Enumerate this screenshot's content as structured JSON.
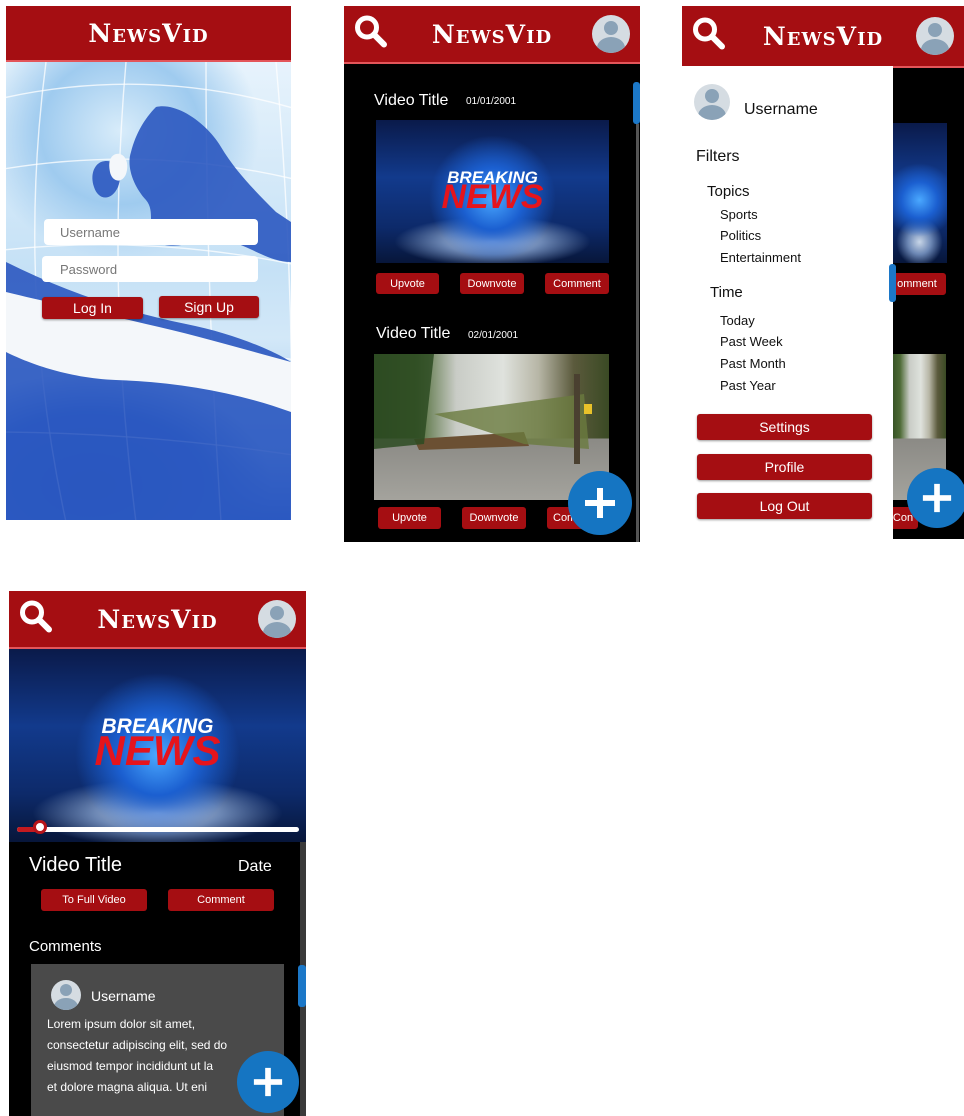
{
  "app": {
    "title": "NewsVid"
  },
  "colors": {
    "header": "#a50e12",
    "fab": "#1575c2",
    "dark_bg": "#000000",
    "drawer_bg": "#ffffff"
  },
  "login": {
    "username_placeholder": "Username",
    "password_placeholder": "Password",
    "login_label": "Log In",
    "signup_label": "Sign Up"
  },
  "feed": {
    "items": [
      {
        "title": "Video Title",
        "date": "01/01/2001",
        "thumb_text_1": "BREAKING",
        "thumb_text_2": "NEWS",
        "actions": [
          "Upvote",
          "Downvote",
          "Comment"
        ]
      },
      {
        "title": "Video Title",
        "date": "02/01/2001",
        "actions": [
          "Upvote",
          "Downvote",
          "Comment"
        ]
      }
    ]
  },
  "drawer": {
    "username": "Username",
    "filters_label": "Filters",
    "topics_label": "Topics",
    "topics": [
      "Sports",
      "Politics",
      "Entertainment"
    ],
    "time_label": "Time",
    "times": [
      "Today",
      "Past Week",
      "Past Month",
      "Past Year"
    ],
    "buttons": [
      "Settings",
      "Profile",
      "Log Out"
    ],
    "peek_comment": "omment",
    "peek_comment_2": "Con"
  },
  "detail": {
    "thumb_text_1": "BREAKING",
    "thumb_text_2": "NEWS",
    "progress": 0.08,
    "title": "Video Title",
    "date": "Date",
    "full_video_label": "To Full Video",
    "comment_label": "Comment",
    "comments_heading": "Comments",
    "comment": {
      "username": "Username",
      "text_lines": [
        "Lorem ipsum dolor sit amet,",
        "consectetur adipiscing elit, sed do",
        "eiusmod tempor incididunt ut la",
        "et dolore magna aliqua. Ut eni"
      ]
    }
  }
}
